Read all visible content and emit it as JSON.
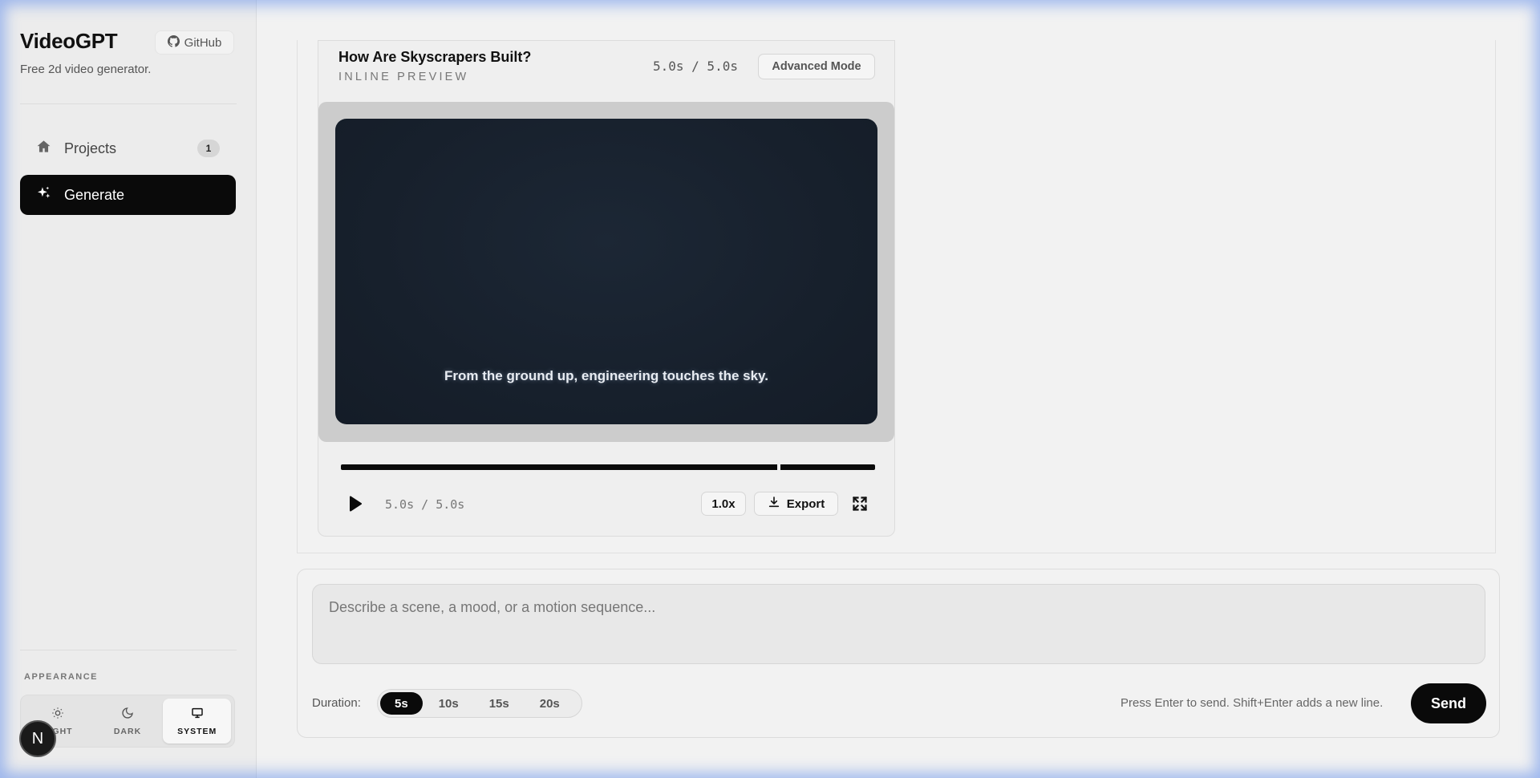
{
  "app": {
    "title": "VideoGPT",
    "subtitle": "Free 2d video generator.",
    "github_label": "GitHub",
    "avatar_letter": "N"
  },
  "sidebar": {
    "items": [
      {
        "label": "Projects",
        "badge": "1",
        "icon": "home-icon",
        "active": false
      },
      {
        "label": "Generate",
        "icon": "sparkles-icon",
        "active": true
      }
    ],
    "appearance_label": "APPEARANCE",
    "themes": [
      {
        "label": "LIGHT",
        "icon": "sun-icon",
        "selected": false
      },
      {
        "label": "DARK",
        "icon": "moon-icon",
        "selected": false
      },
      {
        "label": "SYSTEM",
        "icon": "monitor-icon",
        "selected": true
      }
    ]
  },
  "preview": {
    "title": "How Are Skyscrapers Built?",
    "subtitle": "INLINE PREVIEW",
    "time_header": "5.0s / 5.0s",
    "advanced_label": "Advanced Mode",
    "caption": "From the ground up, engineering touches the sky.",
    "progress": 1.0,
    "time_current": "5.0s / 5.0s",
    "speed": "1.0x",
    "export_label": "Export"
  },
  "composer": {
    "placeholder": "Describe a scene, a mood, or a motion sequence...",
    "value": "",
    "duration_label": "Duration:",
    "durations": [
      "5s",
      "10s",
      "15s",
      "20s"
    ],
    "selected_duration": "5s",
    "hint": "Press Enter to send. Shift+Enter adds a new line.",
    "send_label": "Send"
  },
  "colors": {
    "accent": "#0a0a0a",
    "stage_bg": "#17202c",
    "frame_glow": "#6e96eb"
  }
}
